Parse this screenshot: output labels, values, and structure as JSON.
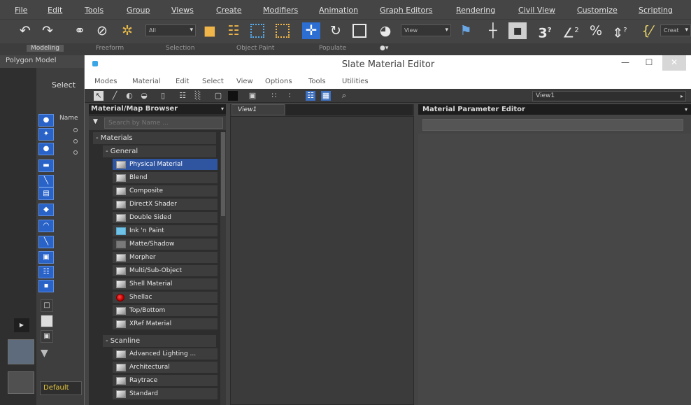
{
  "main_menu": [
    "File",
    "Edit",
    "Tools",
    "Group",
    "Views",
    "Create",
    "Modifiers",
    "Animation",
    "Graph Editors",
    "Rendering",
    "Civil View",
    "Customize",
    "Scripting"
  ],
  "toolbar": {
    "filter_dropdown": "All",
    "view_dropdown": "View",
    "snap_label": "3",
    "angle_snap_label": "2",
    "percent_snap_label": "%",
    "create_selection_label": "Creat"
  },
  "ribbon_tabs": [
    "Modeling",
    "Freeform",
    "Selection",
    "Object Paint",
    "Populate"
  ],
  "polygon_modeling": "Polygon Model",
  "scene_explorer": {
    "select_label": "Select",
    "name_column": "Name",
    "layer_default": "Default"
  },
  "slate": {
    "title": "Slate Material Editor",
    "minimize": "—",
    "maximize": "☐",
    "close": "✕",
    "menu": [
      "Modes",
      "Material",
      "Edit",
      "Select",
      "View",
      "Options",
      "Tools",
      "Utilities"
    ],
    "view_select": "View1",
    "browser": {
      "header": "Material/Map Browser",
      "search_placeholder": "Search by Name ...",
      "group_materials": "- Materials",
      "sub_general": "- General",
      "general_items": [
        {
          "label": "Physical Material",
          "swatch": "sphere",
          "selected": true
        },
        {
          "label": "Blend",
          "swatch": "sphere",
          "selected": false
        },
        {
          "label": "Composite",
          "swatch": "sphere",
          "selected": false
        },
        {
          "label": "DirectX Shader",
          "swatch": "sphere",
          "selected": false
        },
        {
          "label": "Double Sided",
          "swatch": "sphere",
          "selected": false
        },
        {
          "label": "Ink 'n Paint",
          "swatch": "cyan",
          "selected": false
        },
        {
          "label": "Matte/Shadow",
          "swatch": "gray",
          "selected": false
        },
        {
          "label": "Morpher",
          "swatch": "sphere",
          "selected": false
        },
        {
          "label": "Multi/Sub-Object",
          "swatch": "sphere",
          "selected": false
        },
        {
          "label": "Shell Material",
          "swatch": "sphere",
          "selected": false
        },
        {
          "label": "Shellac",
          "swatch": "red",
          "selected": false
        },
        {
          "label": "Top/Bottom",
          "swatch": "sphere",
          "selected": false
        },
        {
          "label": "XRef Material",
          "swatch": "sphere",
          "selected": false
        }
      ],
      "sub_scanline": "- Scanline",
      "scanline_items": [
        {
          "label": "Advanced Lighting ...",
          "swatch": "sphere",
          "selected": false
        },
        {
          "label": "Architectural",
          "swatch": "sphere",
          "selected": false
        },
        {
          "label": "Raytrace",
          "swatch": "sphere",
          "selected": false
        },
        {
          "label": "Standard",
          "swatch": "sphere",
          "selected": false
        }
      ]
    },
    "view_tab": "View1",
    "param_header": "Material Parameter Editor"
  },
  "colors": {
    "accent_blue": "#2c6ed1",
    "selection_blue": "#2f55a1",
    "default_layer_text": "#e2c53a"
  }
}
